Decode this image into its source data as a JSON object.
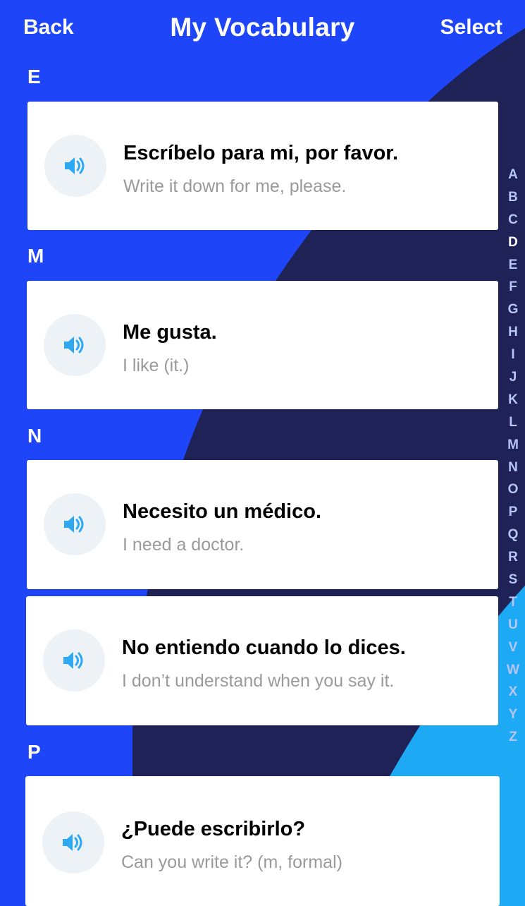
{
  "header": {
    "back_label": "Back",
    "title": "My Vocabulary",
    "select_label": "Select"
  },
  "sections": [
    {
      "letter": "E",
      "items": [
        {
          "phrase": "Escríbelo para mi, por favor.",
          "translation": "Write it down for me, please."
        }
      ]
    },
    {
      "letter": "M",
      "items": [
        {
          "phrase": "Me gusta.",
          "translation": "I like (it.)"
        }
      ]
    },
    {
      "letter": "N",
      "items": [
        {
          "phrase": "Necesito un médico.",
          "translation": "I need a doctor."
        },
        {
          "phrase": "No entiendo cuando lo dices.",
          "translation": "I don’t understand when you say it."
        }
      ]
    },
    {
      "letter": "P",
      "items": [
        {
          "phrase": "¿Puede escribirlo?",
          "translation": "Can you write it? (m, formal)"
        }
      ]
    }
  ],
  "alphabet_index": {
    "letters": [
      "A",
      "B",
      "C",
      "D",
      "E",
      "F",
      "G",
      "H",
      "I",
      "J",
      "K",
      "L",
      "M",
      "N",
      "O",
      "P",
      "Q",
      "R",
      "S",
      "T",
      "U",
      "V",
      "W",
      "X",
      "Y",
      "Z"
    ],
    "active": "D"
  },
  "icons": {
    "speaker": "speaker-icon"
  },
  "colors": {
    "background_blue": "#1e45f7",
    "dark_navy": "#1f2256",
    "light_blue": "#1ea9f5",
    "speaker_icon": "#2ea8f3",
    "speaker_bg": "#edf2f7",
    "translation_text": "#9a9a9a"
  }
}
